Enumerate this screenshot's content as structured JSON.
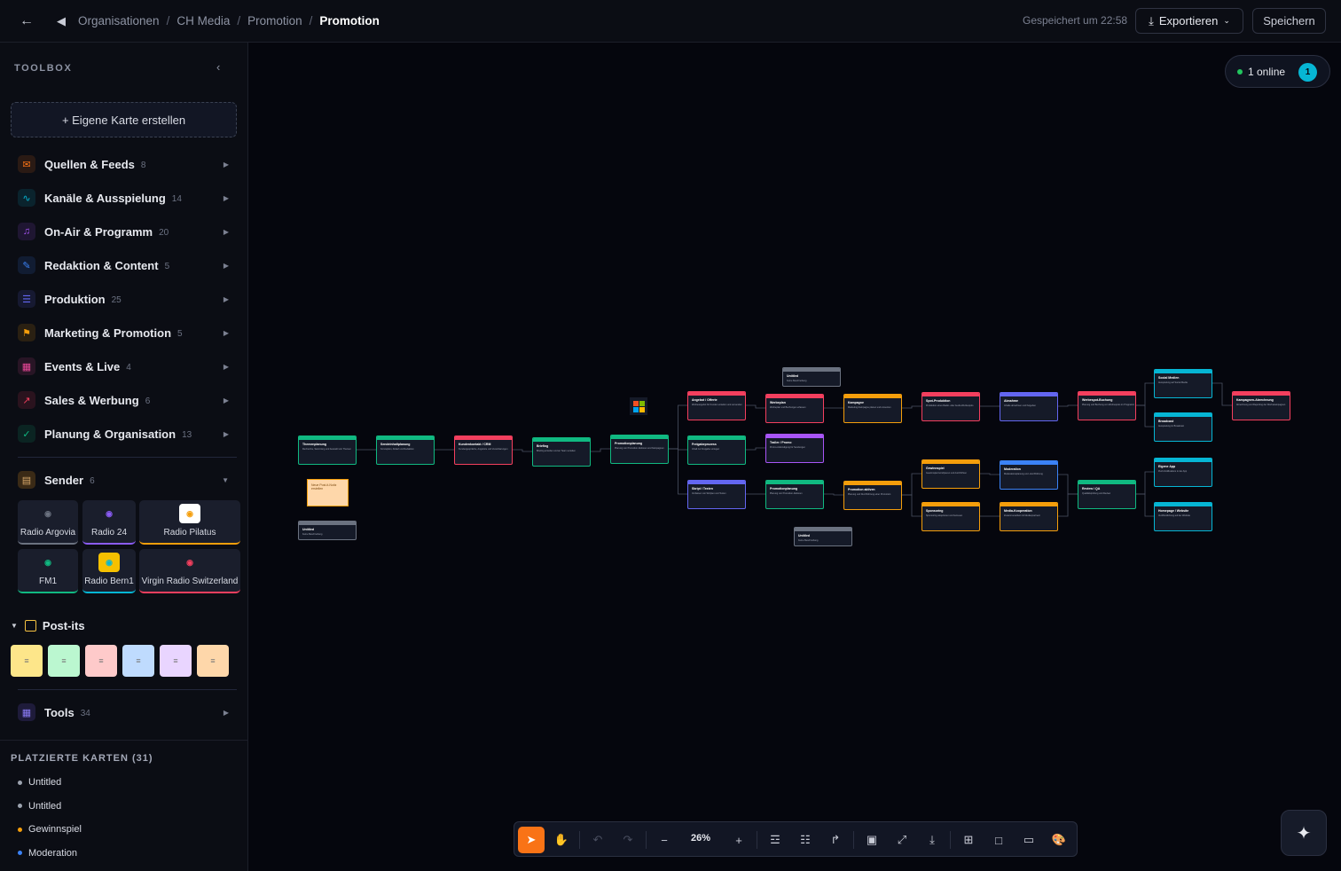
{
  "topbar": {
    "breadcrumbs": [
      "Organisationen",
      "CH Media",
      "Promotion",
      "Promotion"
    ],
    "saved_text": "Gespeichert um 22:58",
    "export_label": "Exportieren",
    "save_label": "Speichern"
  },
  "toolbox": {
    "title": "TOOLBOX",
    "create_card": "+ Eigene Karte erstellen",
    "categories": [
      {
        "label": "Quellen & Feeds",
        "count": "8",
        "color": "#f97316"
      },
      {
        "label": "Kanäle & Ausspielung",
        "count": "14",
        "color": "#06b6d4"
      },
      {
        "label": "On-Air & Programm",
        "count": "20",
        "color": "#a855f7"
      },
      {
        "label": "Redaktion & Content",
        "count": "5",
        "color": "#3b82f6"
      },
      {
        "label": "Produktion",
        "count": "25",
        "color": "#6366f1"
      },
      {
        "label": "Marketing & Promotion",
        "count": "5",
        "color": "#f59e0b"
      },
      {
        "label": "Events & Live",
        "count": "4",
        "color": "#ec4899"
      },
      {
        "label": "Sales & Werbung",
        "count": "6",
        "color": "#f43f5e"
      },
      {
        "label": "Planung & Organisation",
        "count": "13",
        "color": "#10b981"
      }
    ],
    "sender": {
      "label": "Sender",
      "count": "6",
      "stations": [
        {
          "name": "Radio Argovia",
          "color": "#6b7280"
        },
        {
          "name": "Radio 24",
          "color": "#8b5cf6"
        },
        {
          "name": "Radio Pilatus",
          "color": "#f59e0b"
        },
        {
          "name": "FM1",
          "color": "#10b981"
        },
        {
          "name": "Radio Bern1",
          "color": "#06b6d4"
        },
        {
          "name": "Virgin Radio Switzerland",
          "color": "#f43f5e"
        }
      ]
    },
    "postits": {
      "label": "Post-its",
      "colors": [
        "#fde68a",
        "#bbf7d0",
        "#fecaca",
        "#bfdbfe",
        "#e9d5ff",
        "#fed7aa"
      ]
    },
    "tools": {
      "label": "Tools",
      "count": "34"
    }
  },
  "placed": {
    "title": "PLATZIERTE KARTEN (31)",
    "items": [
      {
        "label": "Untitled",
        "color": "#9ca3af"
      },
      {
        "label": "Untitled",
        "color": "#9ca3af"
      },
      {
        "label": "Gewinnspiel",
        "color": "#f59e0b"
      },
      {
        "label": "Moderation",
        "color": "#3b82f6"
      }
    ]
  },
  "presence": {
    "label": "1 online",
    "count": "1"
  },
  "zoom": {
    "value": "26%"
  },
  "canvas": {
    "postit_text": "Neue Post-it-Notiz erstellen",
    "cards": [
      {
        "title": "Themenplanung",
        "desc": "Recherche, Sammlung und Auswahl von Themen",
        "color": "#10b981"
      },
      {
        "title": "Sendeinhaltplanung",
        "desc": "Konzeption, Ablauf und Redaktion",
        "color": "#10b981"
      },
      {
        "title": "Kundenkontakt / CRM",
        "desc": "Kundengespräche, Angebote und Vereinbarungen",
        "color": "#f43f5e"
      },
      {
        "title": "Briefing",
        "desc": "Briefing erstellen und an Team verteilen",
        "color": "#10b981"
      },
      {
        "title": "Promotionplanung",
        "desc": "Planung von Promotion-Aktionen und Kampagnen",
        "color": "#10b981"
      },
      {
        "title": "Angebot / Offerte",
        "desc": "Werbeangebot für Kunden erstellen und versenden",
        "color": "#f43f5e"
      },
      {
        "title": "Werbeplan",
        "desc": "Werbeplan und Buchungen erfassen",
        "color": "#f43f5e"
      },
      {
        "title": "Kampagne",
        "desc": "Marketing-Kampagne planen und umsetzen",
        "color": "#f59e0b"
      },
      {
        "title": "Spot-Produktion",
        "desc": "Produktion eines Radio- oder Audio-Werbespots",
        "color": "#f43f5e"
      },
      {
        "title": "Abnahme",
        "desc": "Inhalte abnehmen und freigeben",
        "color": "#6366f1"
      },
      {
        "title": "Werbespot-Buchung",
        "desc": "Planung und Buchung von Werbespots im Programm",
        "color": "#f43f5e"
      },
      {
        "title": "Social Medien",
        "desc": "Ausspielung auf Social Media",
        "color": "#06b6d4"
      },
      {
        "title": "Broadcast",
        "desc": "Ausspielung im Broadcast",
        "color": "#06b6d4"
      },
      {
        "title": "Kampagnen-Abrechnung",
        "desc": "Abrechnung und Reporting der Werbekampagnen",
        "color": "#f43f5e"
      },
      {
        "title": "Freigabeprozess",
        "desc": "Inhalt zur Freigabe vorlegen",
        "color": "#10b981"
      },
      {
        "title": "Trailer / Promo",
        "desc": "Promo-Ankündigung für Sendungen",
        "color": "#a855f7"
      },
      {
        "title": "Skript / Texten",
        "desc": "Verfassen von Skripten und Texten",
        "color": "#6366f1"
      },
      {
        "title": "Promotionplanung",
        "desc": "Planung von Promotion-Aktionen",
        "color": "#10b981"
      },
      {
        "title": "Promotion aktiven",
        "desc": "Planung und Durchführung einer Promotion",
        "color": "#f59e0b"
      },
      {
        "title": "Gewinnspiel",
        "desc": "Gewinnspiel konzipieren und durchführen",
        "color": "#f59e0b"
      },
      {
        "title": "Moderation",
        "desc": "Moderationsplanung und -durchführung",
        "color": "#3b82f6"
      },
      {
        "title": "Sponsoring",
        "desc": "Sponsoring akquirieren und betreuen",
        "color": "#f59e0b"
      },
      {
        "title": "Media-Kooperation",
        "desc": "Zusammenarbeit mit Medienpartnern",
        "color": "#f59e0b"
      },
      {
        "title": "Review / QA",
        "desc": "Qualitätsprüfung und Review",
        "color": "#10b981"
      },
      {
        "title": "Eigene App",
        "desc": "Push-Notifications in der App",
        "color": "#06b6d4"
      },
      {
        "title": "Homepage / Website",
        "desc": "Veröffentlichung auf der Website",
        "color": "#06b6d4"
      },
      {
        "title": "Untitled",
        "desc": "Keine Beschreibung",
        "color": "#6b7280"
      },
      {
        "title": "Untitled",
        "desc": "Keine Beschreibung",
        "color": "#6b7280"
      },
      {
        "title": "Untitled",
        "desc": "Keine Beschreibung",
        "color": "#6b7280"
      }
    ]
  }
}
